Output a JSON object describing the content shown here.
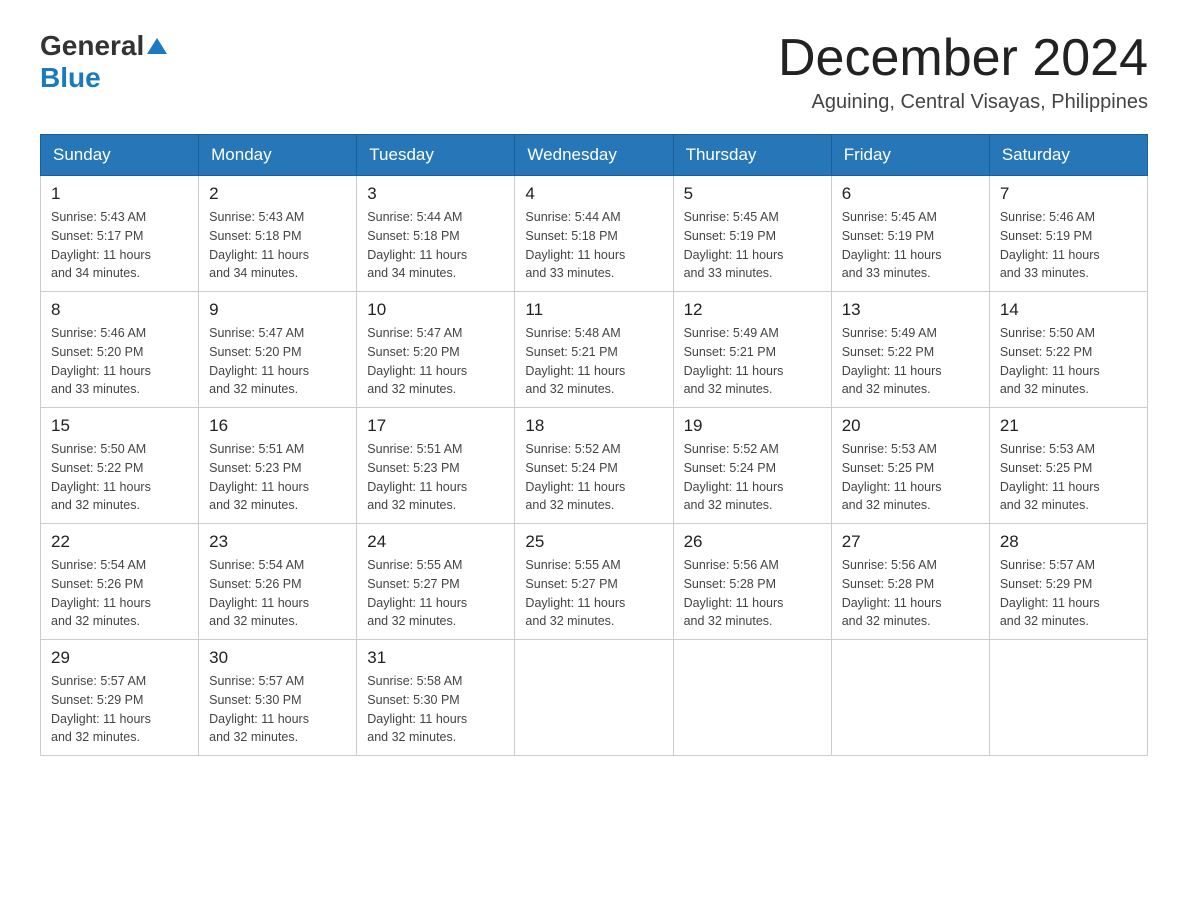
{
  "header": {
    "logo_general": "General",
    "logo_blue": "Blue",
    "month_year": "December 2024",
    "location": "Aguining, Central Visayas, Philippines"
  },
  "weekdays": [
    "Sunday",
    "Monday",
    "Tuesday",
    "Wednesday",
    "Thursday",
    "Friday",
    "Saturday"
  ],
  "weeks": [
    [
      {
        "day": "1",
        "sunrise": "5:43 AM",
        "sunset": "5:17 PM",
        "daylight": "11 hours and 34 minutes."
      },
      {
        "day": "2",
        "sunrise": "5:43 AM",
        "sunset": "5:18 PM",
        "daylight": "11 hours and 34 minutes."
      },
      {
        "day": "3",
        "sunrise": "5:44 AM",
        "sunset": "5:18 PM",
        "daylight": "11 hours and 34 minutes."
      },
      {
        "day": "4",
        "sunrise": "5:44 AM",
        "sunset": "5:18 PM",
        "daylight": "11 hours and 33 minutes."
      },
      {
        "day": "5",
        "sunrise": "5:45 AM",
        "sunset": "5:19 PM",
        "daylight": "11 hours and 33 minutes."
      },
      {
        "day": "6",
        "sunrise": "5:45 AM",
        "sunset": "5:19 PM",
        "daylight": "11 hours and 33 minutes."
      },
      {
        "day": "7",
        "sunrise": "5:46 AM",
        "sunset": "5:19 PM",
        "daylight": "11 hours and 33 minutes."
      }
    ],
    [
      {
        "day": "8",
        "sunrise": "5:46 AM",
        "sunset": "5:20 PM",
        "daylight": "11 hours and 33 minutes."
      },
      {
        "day": "9",
        "sunrise": "5:47 AM",
        "sunset": "5:20 PM",
        "daylight": "11 hours and 32 minutes."
      },
      {
        "day": "10",
        "sunrise": "5:47 AM",
        "sunset": "5:20 PM",
        "daylight": "11 hours and 32 minutes."
      },
      {
        "day": "11",
        "sunrise": "5:48 AM",
        "sunset": "5:21 PM",
        "daylight": "11 hours and 32 minutes."
      },
      {
        "day": "12",
        "sunrise": "5:49 AM",
        "sunset": "5:21 PM",
        "daylight": "11 hours and 32 minutes."
      },
      {
        "day": "13",
        "sunrise": "5:49 AM",
        "sunset": "5:22 PM",
        "daylight": "11 hours and 32 minutes."
      },
      {
        "day": "14",
        "sunrise": "5:50 AM",
        "sunset": "5:22 PM",
        "daylight": "11 hours and 32 minutes."
      }
    ],
    [
      {
        "day": "15",
        "sunrise": "5:50 AM",
        "sunset": "5:22 PM",
        "daylight": "11 hours and 32 minutes."
      },
      {
        "day": "16",
        "sunrise": "5:51 AM",
        "sunset": "5:23 PM",
        "daylight": "11 hours and 32 minutes."
      },
      {
        "day": "17",
        "sunrise": "5:51 AM",
        "sunset": "5:23 PM",
        "daylight": "11 hours and 32 minutes."
      },
      {
        "day": "18",
        "sunrise": "5:52 AM",
        "sunset": "5:24 PM",
        "daylight": "11 hours and 32 minutes."
      },
      {
        "day": "19",
        "sunrise": "5:52 AM",
        "sunset": "5:24 PM",
        "daylight": "11 hours and 32 minutes."
      },
      {
        "day": "20",
        "sunrise": "5:53 AM",
        "sunset": "5:25 PM",
        "daylight": "11 hours and 32 minutes."
      },
      {
        "day": "21",
        "sunrise": "5:53 AM",
        "sunset": "5:25 PM",
        "daylight": "11 hours and 32 minutes."
      }
    ],
    [
      {
        "day": "22",
        "sunrise": "5:54 AM",
        "sunset": "5:26 PM",
        "daylight": "11 hours and 32 minutes."
      },
      {
        "day": "23",
        "sunrise": "5:54 AM",
        "sunset": "5:26 PM",
        "daylight": "11 hours and 32 minutes."
      },
      {
        "day": "24",
        "sunrise": "5:55 AM",
        "sunset": "5:27 PM",
        "daylight": "11 hours and 32 minutes."
      },
      {
        "day": "25",
        "sunrise": "5:55 AM",
        "sunset": "5:27 PM",
        "daylight": "11 hours and 32 minutes."
      },
      {
        "day": "26",
        "sunrise": "5:56 AM",
        "sunset": "5:28 PM",
        "daylight": "11 hours and 32 minutes."
      },
      {
        "day": "27",
        "sunrise": "5:56 AM",
        "sunset": "5:28 PM",
        "daylight": "11 hours and 32 minutes."
      },
      {
        "day": "28",
        "sunrise": "5:57 AM",
        "sunset": "5:29 PM",
        "daylight": "11 hours and 32 minutes."
      }
    ],
    [
      {
        "day": "29",
        "sunrise": "5:57 AM",
        "sunset": "5:29 PM",
        "daylight": "11 hours and 32 minutes."
      },
      {
        "day": "30",
        "sunrise": "5:57 AM",
        "sunset": "5:30 PM",
        "daylight": "11 hours and 32 minutes."
      },
      {
        "day": "31",
        "sunrise": "5:58 AM",
        "sunset": "5:30 PM",
        "daylight": "11 hours and 32 minutes."
      },
      null,
      null,
      null,
      null
    ]
  ],
  "labels": {
    "sunrise": "Sunrise:",
    "sunset": "Sunset:",
    "daylight": "Daylight:"
  }
}
